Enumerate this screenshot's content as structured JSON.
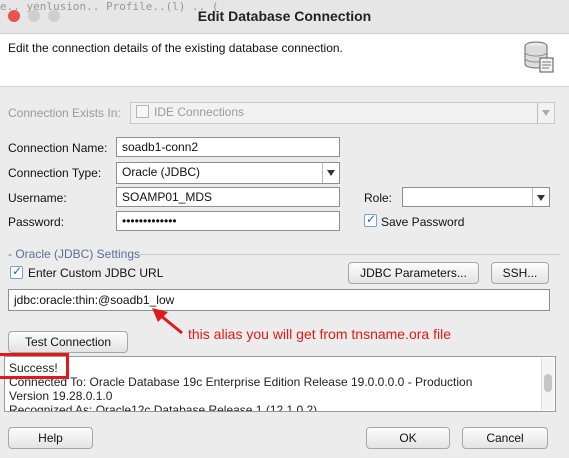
{
  "window": {
    "title": "Edit Database Connection",
    "background_code": "e.. yenlusion.. Profile..(l) .. ("
  },
  "header": {
    "description": "Edit the connection details of the existing database connection.",
    "icon": "database-edit-icon"
  },
  "form": {
    "connection_exists_in": {
      "label": "Connection Exists In:",
      "value": "IDE Connections"
    },
    "connection_name": {
      "label": "Connection Name:",
      "value": "soadb1-conn2"
    },
    "connection_type": {
      "label": "Connection Type:",
      "value": "Oracle (JDBC)"
    },
    "username": {
      "label": "Username:",
      "value": "SOAMP01_MDS"
    },
    "role": {
      "label": "Role:",
      "value": ""
    },
    "password": {
      "label": "Password:",
      "value": "•••••••••••••"
    },
    "save_password": {
      "label": "Save Password",
      "checked": true
    }
  },
  "jdbc_settings": {
    "title": "- Oracle (JDBC) Settings",
    "custom_url": {
      "label": "Enter Custom JDBC URL",
      "checked": true
    },
    "parameters_button": "JDBC Parameters...",
    "ssh_button": "SSH...",
    "url_value": "jdbc:oracle:thin:@soadb1_low"
  },
  "annotation": {
    "text": "this alias you will get from tnsname.ora file",
    "color": "#e01a1a"
  },
  "test": {
    "button": "Test Connection",
    "output": [
      "Success!",
      "Connected To: Oracle Database 19c Enterprise Edition Release 19.0.0.0.0 - Production",
      "Version 19.28.0.1.0",
      "Recognized As: Oracle12c Database Release 1 (12.1.0.2)"
    ]
  },
  "footer": {
    "help": "Help",
    "ok": "OK",
    "cancel": "Cancel"
  }
}
